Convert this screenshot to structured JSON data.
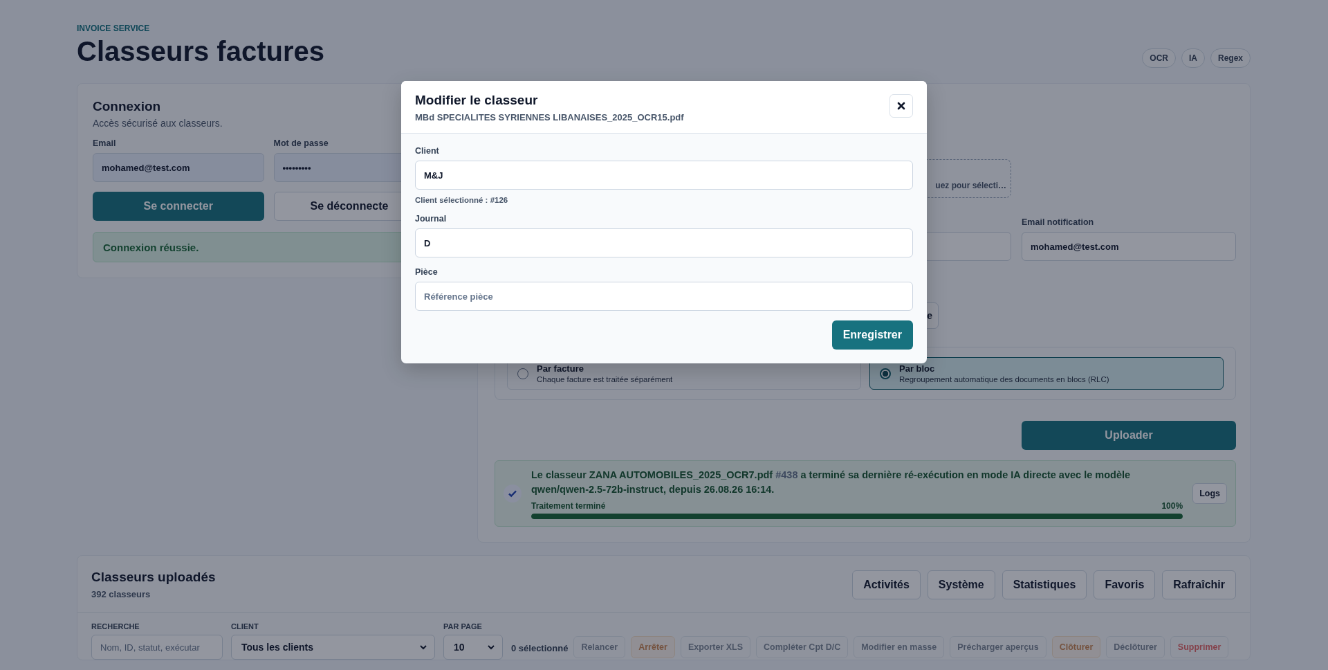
{
  "header": {
    "eyebrow": "INVOICE SERVICE",
    "title": "Classeurs factures",
    "badges": [
      "OCR",
      "IA",
      "Regex"
    ]
  },
  "login": {
    "title": "Connexion",
    "subtitle": "Accès sécurisé aux classeurs.",
    "fields": [
      {
        "label": "Email",
        "value": "mohamed@test.com"
      },
      {
        "label": "Mot de passe",
        "value": "•••••••••"
      }
    ],
    "buttons": [
      {
        "label": "Se connecter",
        "kind": "primary"
      },
      {
        "label": "Se déconnecte",
        "kind": "secondary"
      }
    ],
    "message": "Connexion réussie."
  },
  "upload": {
    "dropzone_text": "uez pour sélecti…",
    "notification": {
      "label": "Email notification",
      "value": "mohamed@test.com"
    },
    "partial_button": "e",
    "modes": [
      {
        "label": "Par facture",
        "description": "Chaque facture est traitée séparément",
        "selected": false
      },
      {
        "label": "Par bloc",
        "description": "Regroupement automatique des documents en blocs (RLC)",
        "selected": true
      }
    ],
    "upload_button": "Uploader",
    "status": {
      "message_before": "Le classeur ZANA AUTOMOBILES_2025_OCR7.pdf ",
      "message_id": "#438",
      "message_after": " a terminé sa dernière ré-exécution en mode IA directe avec le modèle qwen/qwen-2.5-72b-instruct, depuis 26.08.26 16:14.",
      "progress_label": "Traitement terminé",
      "progress_value": "100%",
      "level": 1,
      "logs_button": "Logs"
    }
  },
  "list": {
    "title": "Classeurs uploadés",
    "count": "392 classeurs",
    "buttons": [
      "Activités",
      "Système",
      "Statistiques",
      "Favoris",
      "Rafraîchir"
    ],
    "search": {
      "label": "RECHERCHE",
      "placeholder": "Nom, ID, statut, exécutar"
    },
    "client": {
      "label": "CLIENT",
      "value": "Tous les clients"
    },
    "per_page": {
      "label": "PAR PAGE",
      "value": "10"
    },
    "selected_count": "0 sélectionné",
    "actions": [
      {
        "label": "Relancer",
        "kind": "neutral",
        "disabled": true
      },
      {
        "label": "Arrêter",
        "kind": "warning",
        "disabled": true
      },
      {
        "label": "Exporter XLS",
        "kind": "neutral",
        "disabled": true
      },
      {
        "label": "Compléter Cpt D/C",
        "kind": "neutral",
        "disabled": true
      },
      {
        "label": "Modifier en masse",
        "kind": "neutral",
        "disabled": true
      },
      {
        "label": "Précharger aperçus",
        "kind": "neutral",
        "disabled": true
      },
      {
        "label": "Clôturer",
        "kind": "warning",
        "disabled": true
      },
      {
        "label": "Déclôturer",
        "kind": "neutral",
        "disabled": true
      },
      {
        "label": "Supprimer",
        "kind": "danger",
        "disabled": true
      }
    ]
  },
  "modal": {
    "title": "Modifier le classeur",
    "subtitle": "MBd SPECIALITES SYRIENNES LIBANAISES_2025_OCR15.pdf",
    "fields": [
      {
        "label": "Client",
        "value": "M&J",
        "hint": "Client sélectionné : #126"
      },
      {
        "label": "Journal",
        "value": "D"
      },
      {
        "label": "Pièce",
        "placeholder": "Référence pièce"
      }
    ],
    "save_button": "Enregistrer"
  }
}
